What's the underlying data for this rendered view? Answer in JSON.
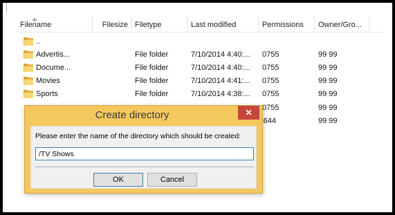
{
  "file_list": {
    "columns": {
      "filename": "Filename",
      "filesize": "Filesize",
      "filetype": "Filetype",
      "last_modified": "Last modified",
      "permissions": "Permissions",
      "owner_group": "Owner/Gro..."
    },
    "rows": [
      {
        "name": "..",
        "type": "",
        "modified": "",
        "permissions": "",
        "owner": ""
      },
      {
        "name": "Advertis...",
        "type": "File folder",
        "modified": "7/10/2014 4:40:...",
        "permissions": "0755",
        "owner": "99 99"
      },
      {
        "name": "Docume...",
        "type": "File folder",
        "modified": "7/10/2014 4:40:...",
        "permissions": "0755",
        "owner": "99 99"
      },
      {
        "name": "Movies",
        "type": "File folder",
        "modified": "7/10/2014 4:41:...",
        "permissions": "0755",
        "owner": "99 99"
      },
      {
        "name": "Sports",
        "type": "File folder",
        "modified": "7/10/2014 4:38:...",
        "permissions": "0755",
        "owner": "99 99"
      },
      {
        "name": "",
        "type": "",
        "modified": "",
        "permissions": "0755",
        "owner": "99 99"
      },
      {
        "name": "",
        "type": "",
        "modified": "",
        "permissions": ")644",
        "owner": "99 99"
      }
    ]
  },
  "dialog": {
    "title": "Create directory",
    "close_glyph": "✕",
    "prompt": "Please enter the name of the directory which should be created:",
    "input_value": "/TV Shows",
    "ok_label": "OK",
    "cancel_label": "Cancel"
  },
  "colors": {
    "dialog_frame": "#f5c85e",
    "close_button": "#c7463c",
    "folder": "#e8b34a"
  }
}
